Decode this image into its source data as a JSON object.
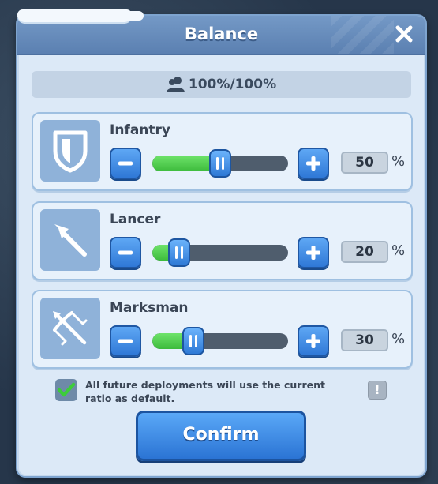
{
  "dialog": {
    "title": "Balance",
    "close_icon": "close-icon",
    "capacity_icon": "users-icon",
    "capacity_text": "100%/100%"
  },
  "troops": [
    {
      "name": "Infantry",
      "icon": "shield-icon",
      "percent": "50",
      "unit": "%",
      "slider_value": 50
    },
    {
      "name": "Lancer",
      "icon": "lance-icon",
      "percent": "20",
      "unit": "%",
      "slider_value": 20
    },
    {
      "name": "Marksman",
      "icon": "crossbow-icon",
      "percent": "30",
      "unit": "%",
      "slider_value": 30
    }
  ],
  "default_option": {
    "checked": true,
    "text": "All future deployments will use the current ratio as default.",
    "info_label": "!"
  },
  "confirm_label": "Confirm",
  "colors": {
    "accent": "#2f78d6",
    "slider_fill": "#3dbb3c",
    "panel": "#dce9f7"
  }
}
